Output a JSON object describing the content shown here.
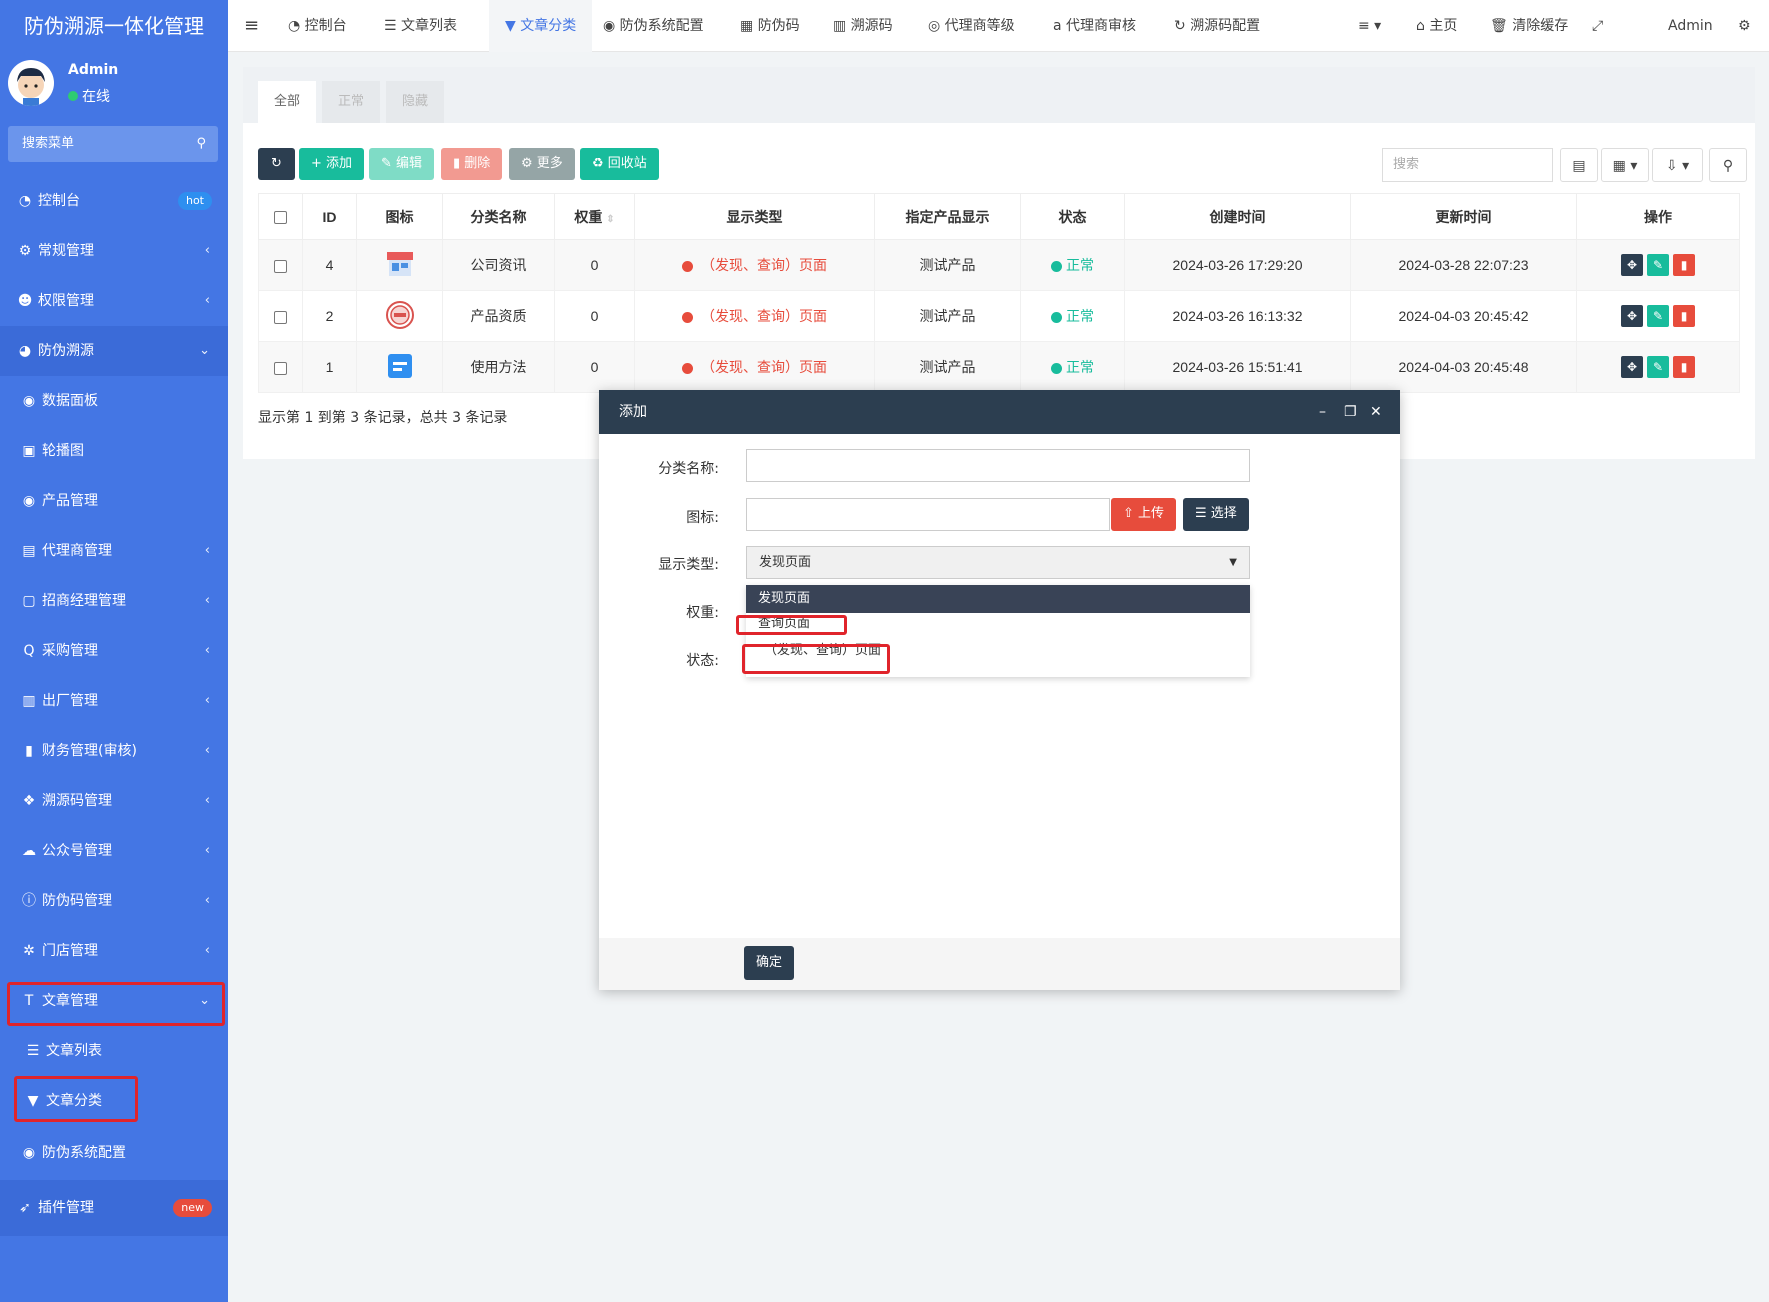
{
  "app_title": "防伪溯源一体化管理",
  "user": {
    "name": "Admin",
    "status": "在线"
  },
  "sidebar": {
    "search_placeholder": "搜索菜单",
    "items": [
      {
        "label": "控制台",
        "icon": "dashboard-icon",
        "badge": "hot"
      },
      {
        "label": "常规管理",
        "icon": "cogs-icon"
      },
      {
        "label": "权限管理",
        "icon": "group-icon"
      },
      {
        "label": "防伪溯源",
        "icon": "pie-icon"
      },
      {
        "label": "数据面板",
        "icon": "circle-icon"
      },
      {
        "label": "轮播图",
        "icon": "image-icon"
      },
      {
        "label": "产品管理",
        "icon": "circle-icon"
      },
      {
        "label": "代理商管理",
        "icon": "card-icon"
      },
      {
        "label": "招商经理管理",
        "icon": "portrait-icon"
      },
      {
        "label": "采购管理",
        "icon": "search-icon"
      },
      {
        "label": "出厂管理",
        "icon": "truck-icon"
      },
      {
        "label": "财务管理(审核)",
        "icon": "money-icon"
      },
      {
        "label": "溯源码管理",
        "icon": "cubes-icon"
      },
      {
        "label": "公众号管理",
        "icon": "wechat-icon"
      },
      {
        "label": "防伪码管理",
        "icon": "info-icon"
      },
      {
        "label": "门店管理",
        "icon": "asterisk-icon"
      },
      {
        "label": "文章管理",
        "icon": "text-icon"
      },
      {
        "label": "文章列表",
        "icon": "list-icon"
      },
      {
        "label": "文章分类",
        "icon": "filter-icon"
      },
      {
        "label": "防伪系统配置",
        "icon": "circle-icon"
      },
      {
        "label": "插件管理",
        "icon": "rocket-icon",
        "badge": "new"
      }
    ]
  },
  "topbar": {
    "tabs": [
      "控制台",
      "文章列表",
      "文章分类",
      "防伪系统配置",
      "防伪码",
      "溯源码",
      "代理商等级",
      "代理商审核",
      "溯源码配置"
    ],
    "right": [
      "主页",
      "清除缓存",
      "Admin"
    ]
  },
  "filter_tabs": [
    "全部",
    "正常",
    "隐藏"
  ],
  "toolbar": {
    "add": "添加",
    "edit": "编辑",
    "delete": "删除",
    "more": "更多",
    "recycle": "回收站",
    "search_placeholder": "搜索"
  },
  "table": {
    "headers": [
      "ID",
      "图标",
      "分类名称",
      "权重",
      "显示类型",
      "指定产品显示",
      "状态",
      "创建时间",
      "更新时间",
      "操作"
    ],
    "rows": [
      {
        "id": "4",
        "name": "公司资讯",
        "weight": "0",
        "type": "（发现、查询）页面",
        "product": "测试产品",
        "status": "正常",
        "created": "2024-03-26 17:29:20",
        "updated": "2024-03-28 22:07:23"
      },
      {
        "id": "2",
        "name": "产品资质",
        "weight": "0",
        "type": "（发现、查询）页面",
        "product": "测试产品",
        "status": "正常",
        "created": "2024-03-26 16:13:32",
        "updated": "2024-04-03 20:45:42"
      },
      {
        "id": "1",
        "name": "使用方法",
        "weight": "0",
        "type": "（发现、查询）页面",
        "product": "测试产品",
        "status": "正常",
        "created": "2024-03-26 15:51:41",
        "updated": "2024-04-03 20:45:48"
      }
    ],
    "summary": "显示第 1 到第 3 条记录，总共 3 条记录"
  },
  "modal": {
    "title": "添加",
    "labels": {
      "name": "分类名称:",
      "icon": "图标:",
      "type": "显示类型:",
      "weight": "权重:",
      "status": "状态:"
    },
    "upload": "上传",
    "choose": "选择",
    "type_value": "发现页面",
    "options": [
      "发现页面",
      "查询页面",
      "（发现、查询）页面"
    ],
    "confirm": "确定"
  },
  "colors": {
    "sidebar": "#4476e4",
    "modal_header": "#2c3e50",
    "success": "#18bc9c",
    "danger": "#e74c3c",
    "highlight": "#e0242b"
  }
}
